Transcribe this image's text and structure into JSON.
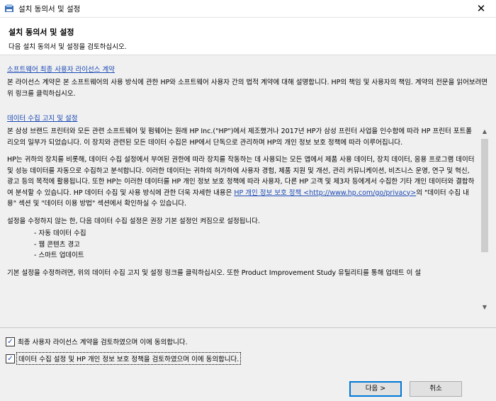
{
  "window": {
    "title": "설치 동의서 및 설정",
    "close_glyph": "✕"
  },
  "header": {
    "title": "설치 동의서 및 설정",
    "subtitle": "다음 설치 동의서 및 설정을 검토하십시오."
  },
  "eula": {
    "link": "소프트웨어 최종 사용자 라이선스 계약",
    "text": "본 라이선스 계약은 본 소프트웨어의 사용 방식에 관한 HP와 소프트웨어 사용자 간의 법적 계약에 대해 설명합니다. HP의 책임 및 사용자의 책임. 계약의 전문을 읽어보려면 위 링크를 클릭하십시오."
  },
  "data_notice": {
    "link": "데이터 수집 고지 및 설정",
    "p1": "본 삼성 브랜드 프린터와 모든 관련 소프트웨어 및 펌웨어는 원래 HP Inc.(\"HP\")에서 제조했거나 2017년 HP가 삼성 프린터 사업을 인수함에 따라 HP 프린터 포트폴리오의 일부가 되었습니다. 이 장치와 관련된 모든 데이터 수집은 HP에서 단독으로 관리하며 HP의 개인 정보 보호 정책에 따라 이루어집니다.",
    "p2_before": "HP는 귀하의 장치를 비롯해, 데이터 수집 설정에서 부여된 권한에 따라 장치를 작동하는 데 사용되는 모든 앱에서 제품 사용 데이터, 장치 데이터, 응용 프로그램 데이터 및 성능 데이터를 자동으로 수집하고 분석합니다. 이러한 데이터는 귀하의 허가하에 사용자 경험, 제품 지원 및 개선, 관리 커뮤니케이션, 비즈니스 운영, 연구 및 혁신, 광고 등의 목적에 활용됩니다. 또한 HP는 이러한 데이터를 HP 개인 정보 보호 정책에 따라 사용자, 다른 HP 고객 및 제3자 등에게서 수집한 기타 개인 데이터와 결합하여 분석할 수 있습니다. HP 데이터 수집 및 사용 방식에 관한 더욱 자세한 내용은 ",
    "p2_link": "HP 개인 정보 보호 정책 <http://www.hp.com/go/privacy>",
    "p2_after": "의 \"데이터 수집 내용\" 섹션 및 \"데이터 이용 방법\" 섹션에서 확인하실 수 있습니다.",
    "p3": "설정을 수정하지 않는 한, 다음 데이터 수집 설정은 권장 기본 설정인 켜짐으로 설정됩니다.",
    "bullets": [
      "- 자동 데이터 수집",
      "- 웹 콘텐츠 경고",
      "- 스마트 업데이트"
    ],
    "p4": "기본 설정을 수정하려면, 위의 데이터 수집 고지 및 설정 링크를 클릭하십시오. 또한 Product Improvement Study 유틸리티를 통해 업데트 이 설"
  },
  "checkboxes": [
    {
      "label": "최종 사용자 라이선스 계약을 검토하였으며 이에 동의합니다.",
      "checked": true
    },
    {
      "label": "데이터 수집 설정 및 HP 개인 정보 보호 정책을 검토하였으며 이에 동의합니다.",
      "checked": true
    }
  ],
  "check_glyph": "✓",
  "buttons": {
    "next": "다음 >",
    "cancel": "취소"
  },
  "scrollbar": {
    "up_glyph": "▲",
    "down_glyph": "▼"
  }
}
